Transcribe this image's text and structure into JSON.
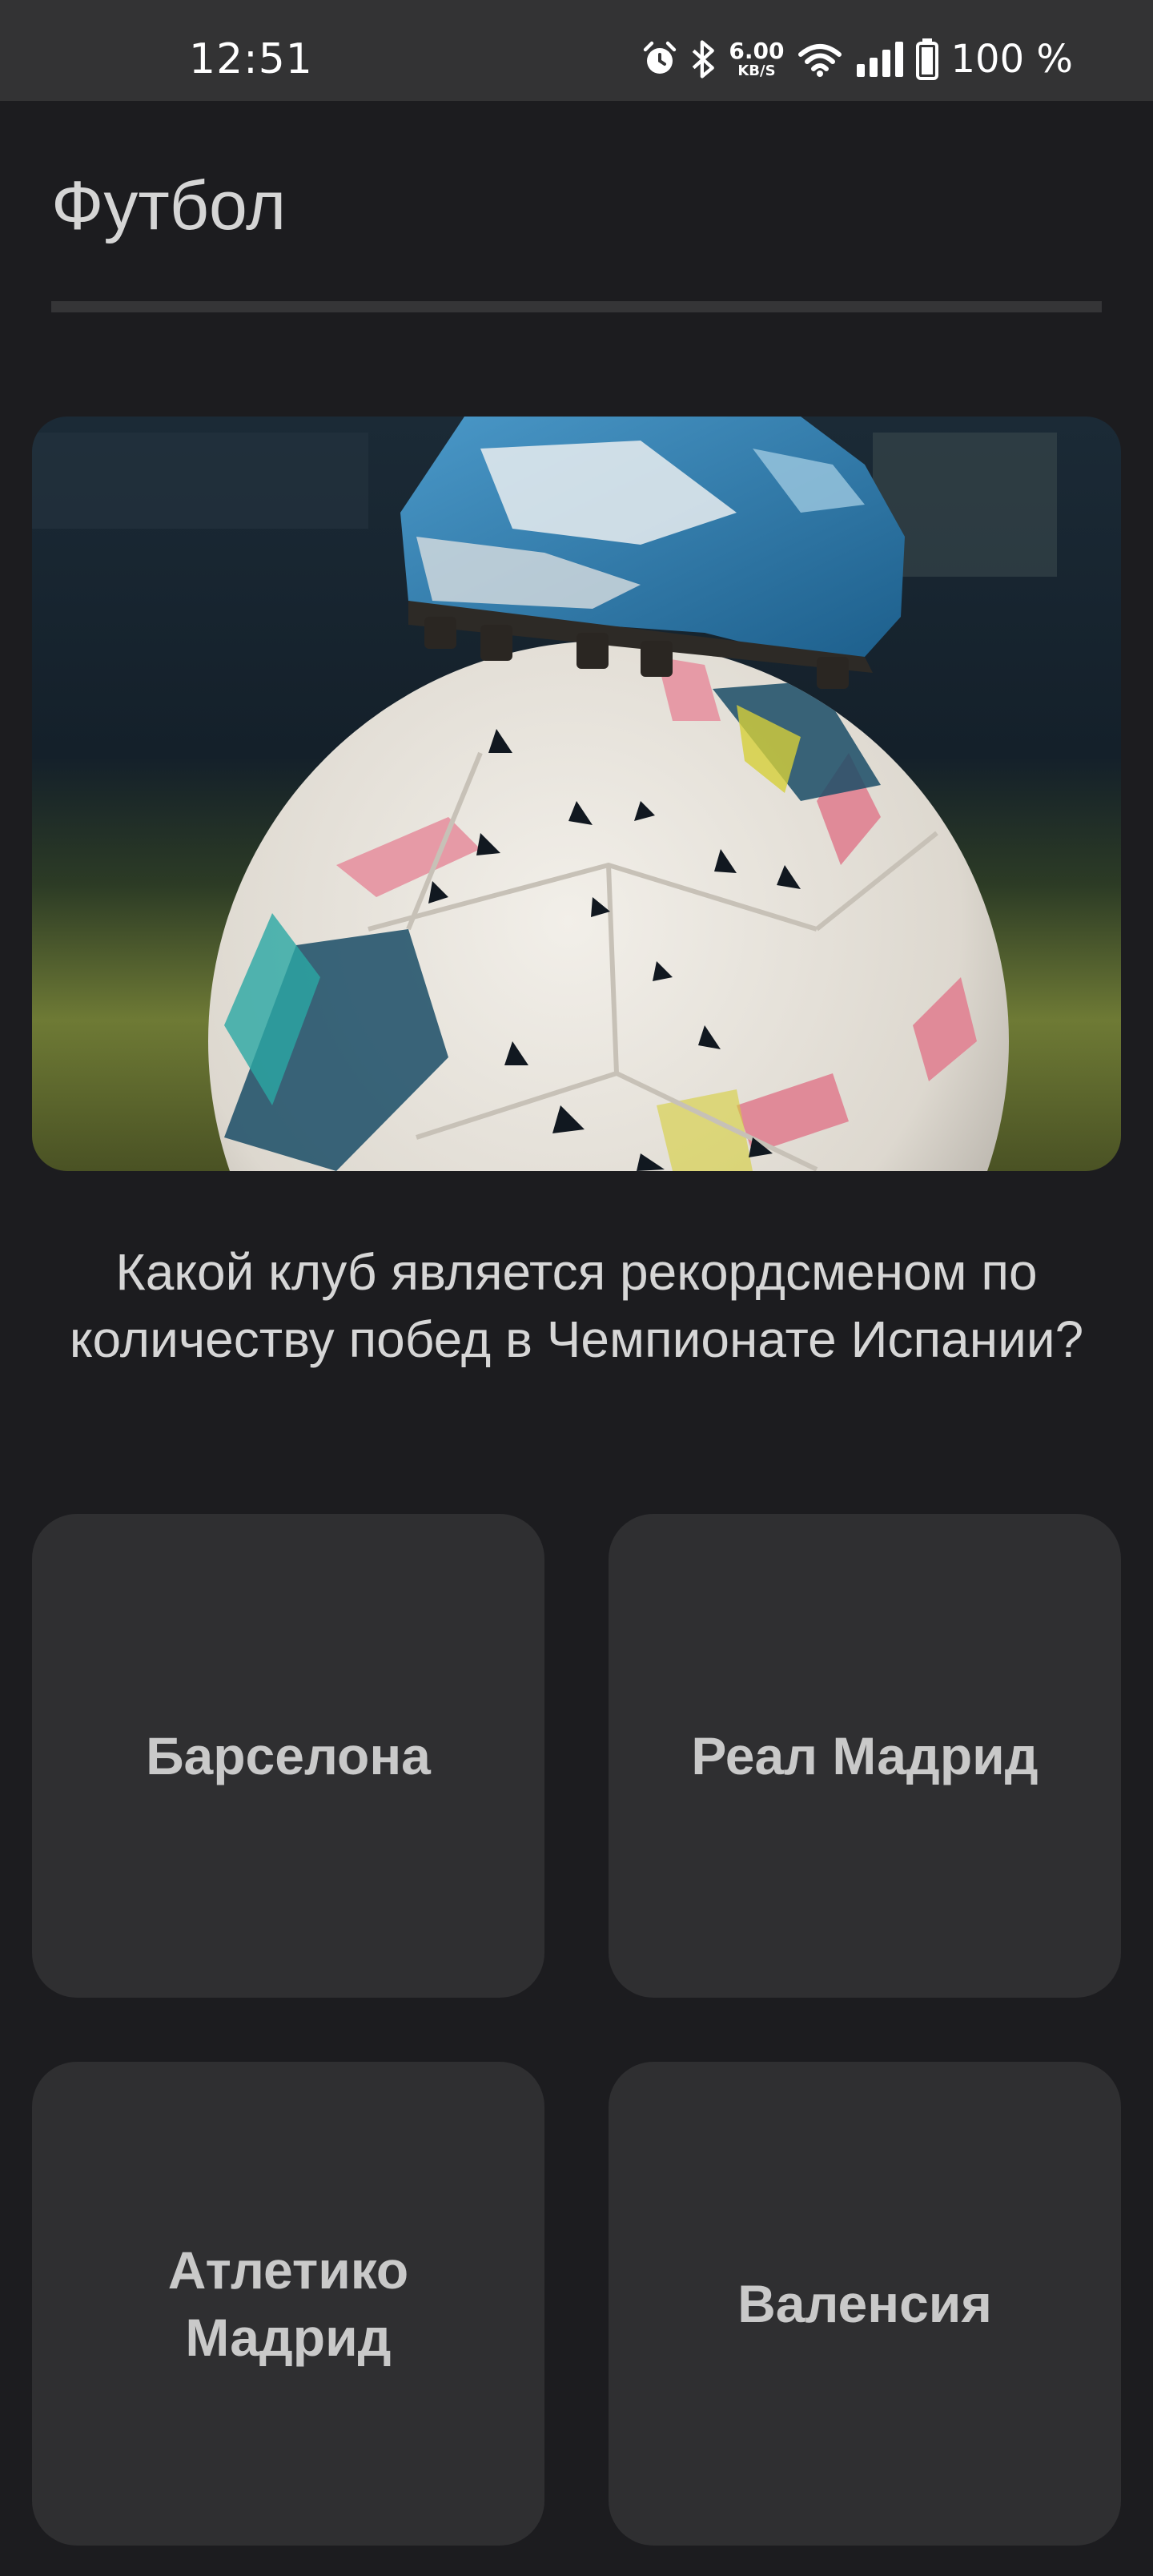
{
  "status_bar": {
    "time": "12:51",
    "net_speed_value": "6.00",
    "net_speed_unit": "KB/S",
    "battery": "100 %",
    "icons": [
      "alarm-icon",
      "bluetooth-icon",
      "wifi-icon",
      "signal-icon",
      "battery-icon"
    ]
  },
  "header": {
    "title": "Футбол"
  },
  "hero": {
    "image": "soccer-ball-with-boot-photo"
  },
  "quiz": {
    "question": "Какой клуб является рекордсменом по количеству побед в Чемпионате Испании?",
    "answers": [
      {
        "label": "Барселона"
      },
      {
        "label": "Реал Мадрид"
      },
      {
        "label": "Атлетико\nМадрид"
      },
      {
        "label": "Валенсия"
      }
    ]
  },
  "colors": {
    "background": "#1c1c1f",
    "status_bar": "#333334",
    "card": "#2f2f31",
    "text": "#d6d6d6"
  }
}
